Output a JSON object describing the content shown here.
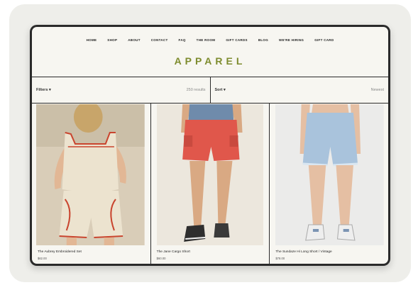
{
  "nav": [
    "HOME",
    "SHOP",
    "ABOUT",
    "CONTACT",
    "FAQ",
    "THE ROOM",
    "GIFT CARDS",
    "BLOG",
    "WE'RE HIRING",
    "GIFT CARD"
  ],
  "brand": {
    "name": "APPAREL",
    "color": "#7e8c2e"
  },
  "filters": {
    "label": "Filters",
    "results": "250 results"
  },
  "sort": {
    "label": "Sort",
    "value": "Newest"
  },
  "icons": {
    "dropdown": "chevron-down-icon"
  },
  "products": [
    {
      "name": "The Aubrey Embroidered Set",
      "price": "$62.00"
    },
    {
      "name": "The Jane Cargo Short",
      "price": "$60.00"
    },
    {
      "name": "The Sundaze Hi Long Short / Vintage",
      "price": "$78.00"
    }
  ]
}
